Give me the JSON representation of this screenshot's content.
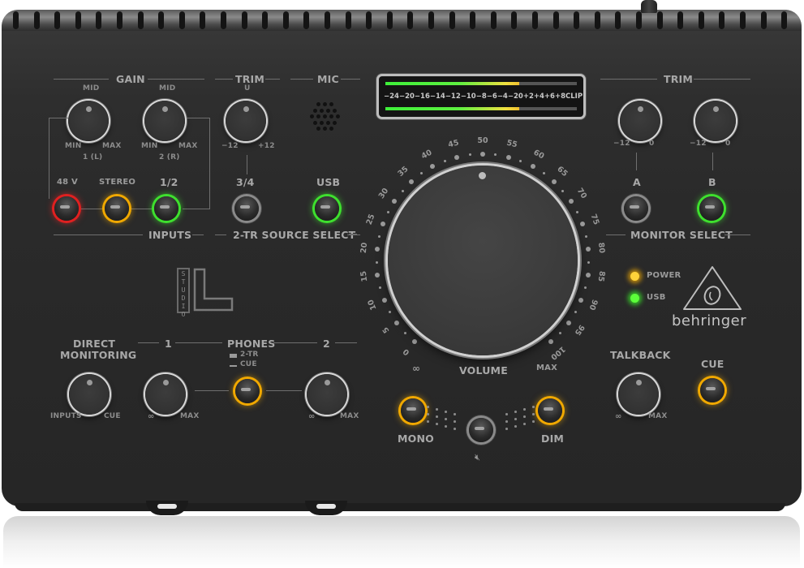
{
  "device": {
    "brand": "behringer",
    "model_logo": "STUDIO L",
    "model_logo_vertical": "STUDIO",
    "model_logo_letter": "L"
  },
  "input_section": {
    "gain_header": "GAIN",
    "gain_knobs": [
      {
        "top": "MID",
        "min": "MIN",
        "max": "MAX",
        "channel": "1 (L)"
      },
      {
        "top": "MID",
        "min": "MIN",
        "max": "MAX",
        "channel": "2 (R)"
      }
    ],
    "trim_header": "TRIM",
    "trim_knob": {
      "top": "U",
      "min": "−12",
      "max": "+12"
    },
    "mic_header": "MIC",
    "buttons": [
      {
        "label": "48 V",
        "state": "red"
      },
      {
        "label": "STEREO",
        "state": "amber"
      },
      {
        "label": "1/2",
        "state": "green"
      }
    ],
    "inputs_footer": "INPUTS"
  },
  "two_tr_source": {
    "footer": "2-TR SOURCE SELECT",
    "buttons": [
      {
        "label": "3/4",
        "state": "off"
      },
      {
        "label": "USB",
        "state": "green"
      }
    ]
  },
  "meter": {
    "scale": [
      "−24",
      "−20",
      "−16",
      "−14",
      "−12",
      "−10",
      "−8",
      "−6",
      "−4",
      "−2",
      "0",
      "+2",
      "+4",
      "+6",
      "+8",
      "CLIP"
    ],
    "left_level_fraction": 0.7,
    "right_level_fraction": 0.7
  },
  "volume": {
    "label": "VOLUME",
    "min_label": "∞",
    "max_label": "MAX",
    "scale": [
      "0",
      "5",
      "10",
      "15",
      "20",
      "25",
      "30",
      "35",
      "40",
      "45",
      "50",
      "55",
      "60",
      "65",
      "70",
      "75",
      "80",
      "85",
      "90",
      "95",
      "100"
    ],
    "position_value": 50
  },
  "monitor": {
    "trim_header": "TRIM",
    "trim_knobs": [
      {
        "min": "−12",
        "max": "0"
      },
      {
        "min": "−12",
        "max": "0"
      }
    ],
    "select_buttons": [
      {
        "label": "A",
        "state": "off"
      },
      {
        "label": "B",
        "state": "green"
      }
    ],
    "footer": "MONITOR SELECT"
  },
  "status": {
    "leds": [
      {
        "label": "POWER",
        "color": "#ffd23a"
      },
      {
        "label": "USB",
        "color": "#5cff3a"
      }
    ]
  },
  "direct_monitoring": {
    "title_line1": "DIRECT",
    "title_line2": "MONITORING",
    "min": "INPUTS",
    "max": "CUE"
  },
  "phones": {
    "header": "PHONES",
    "ch1": "1",
    "ch2": "2",
    "mode_up": "2-TR",
    "mode_down": "CUE",
    "knob1": {
      "min": "∞",
      "max": "MAX"
    },
    "knob2": {
      "min": "∞",
      "max": "MAX"
    },
    "switch_state": "amber"
  },
  "bottom_buttons": {
    "mono": "MONO",
    "dim": "DIM",
    "mute_icon": "speaker-mute"
  },
  "talkback": {
    "label": "TALKBACK",
    "min": "∞",
    "max": "MAX",
    "cue_label": "CUE",
    "cue_state": "amber"
  },
  "colors": {
    "led_red": "#e02020",
    "led_amber": "#f0a800",
    "led_green": "#3ee02e",
    "panel": "#2a2a2a",
    "label": "#a4a4a4"
  }
}
